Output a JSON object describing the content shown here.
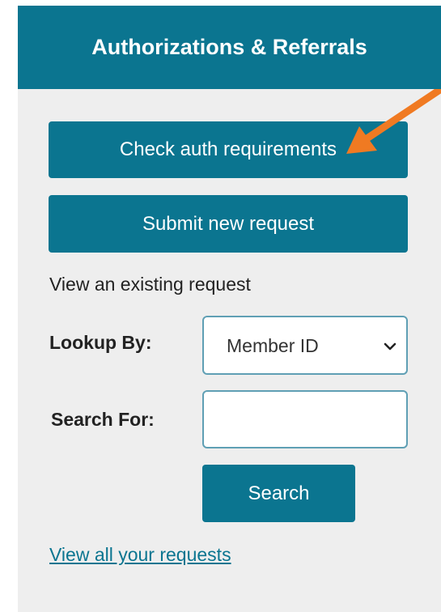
{
  "header": {
    "title": "Authorizations & Referrals"
  },
  "buttons": {
    "check_auth": "Check auth requirements",
    "submit_new": "Submit new request",
    "search": "Search"
  },
  "existing": {
    "heading": "View an existing request",
    "lookup_label": "Lookup By:",
    "lookup_value": "Member ID",
    "search_label": "Search For:",
    "search_value": ""
  },
  "links": {
    "view_all": "View all your requests"
  },
  "colors": {
    "brand": "#0b7590",
    "panel_bg": "#eeeeee",
    "annotation_arrow": "#f07a22"
  },
  "icons": {
    "dropdown": "chevron-down-icon",
    "annotation": "arrow-annotation"
  }
}
